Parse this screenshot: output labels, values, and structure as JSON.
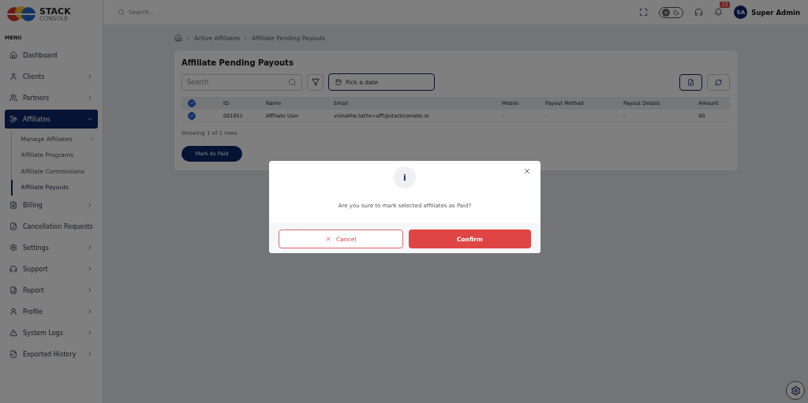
{
  "sidebar": {
    "logo": {
      "line1": "STACK",
      "line2": "CONSOLE"
    },
    "menu_label": "MENU",
    "items": [
      {
        "label": "Dashboard",
        "selected": false,
        "chevron": false
      },
      {
        "label": "Clients",
        "selected": false,
        "chevron": true
      },
      {
        "label": "Partners",
        "selected": false,
        "chevron": true
      },
      {
        "label": "Affiliates",
        "selected": true,
        "chevron": true,
        "expanded": true,
        "children": [
          {
            "label": "Manage Affiliates",
            "selected": false,
            "chevron": true
          },
          {
            "label": "Affiliate Programs",
            "selected": false,
            "chevron": false
          },
          {
            "label": "Affiliate Commissions",
            "selected": false,
            "chevron": false
          },
          {
            "label": "Affiliate Payouts",
            "selected": true,
            "chevron": false
          }
        ]
      },
      {
        "label": "Billing",
        "selected": false,
        "chevron": true
      },
      {
        "label": "Cancellation Requests",
        "selected": false,
        "chevron": false
      },
      {
        "label": "Settings",
        "selected": false,
        "chevron": true
      },
      {
        "label": "Support",
        "selected": false,
        "chevron": true
      },
      {
        "label": "Report",
        "selected": false,
        "chevron": true
      },
      {
        "label": "Profile",
        "selected": false,
        "chevron": true
      },
      {
        "label": "System Logs",
        "selected": false,
        "chevron": true
      },
      {
        "label": "Exported History",
        "selected": false,
        "chevron": true
      }
    ]
  },
  "topbar": {
    "dark_mode": false,
    "search": {
      "placeholder": "Search..."
    },
    "notifications": "22",
    "user": {
      "initials": "SA",
      "name": "Super Admin"
    }
  },
  "breadcrumb": [
    "Active Affiliates",
    "Affiliate Pending Payouts"
  ],
  "card": {
    "title": "Affiliate Pending Payouts",
    "search": {
      "placeholder": "Search"
    },
    "date": {
      "placeholder": "Pick a date"
    },
    "table": {
      "all_checked": true,
      "columns": [
        "ID",
        "Name",
        "Email",
        "Mobile",
        "Payout Method",
        "Payout Details",
        "Amount"
      ],
      "rows": [
        {
          "selected": true,
          "cells": [
            "001051",
            "Affiliate User",
            "vishakha.tathe+affi@stackconsole.io",
            "-",
            "-",
            "-",
            "90"
          ]
        }
      ]
    },
    "footer": "Showing 1 of 1 rows",
    "action": "Mark As Paid"
  },
  "dialog": {
    "icon_text": "i",
    "message": "Are you sure to mark selected affiliates as Paid?",
    "cancel": "Cancel",
    "confirm": "Confirm"
  }
}
